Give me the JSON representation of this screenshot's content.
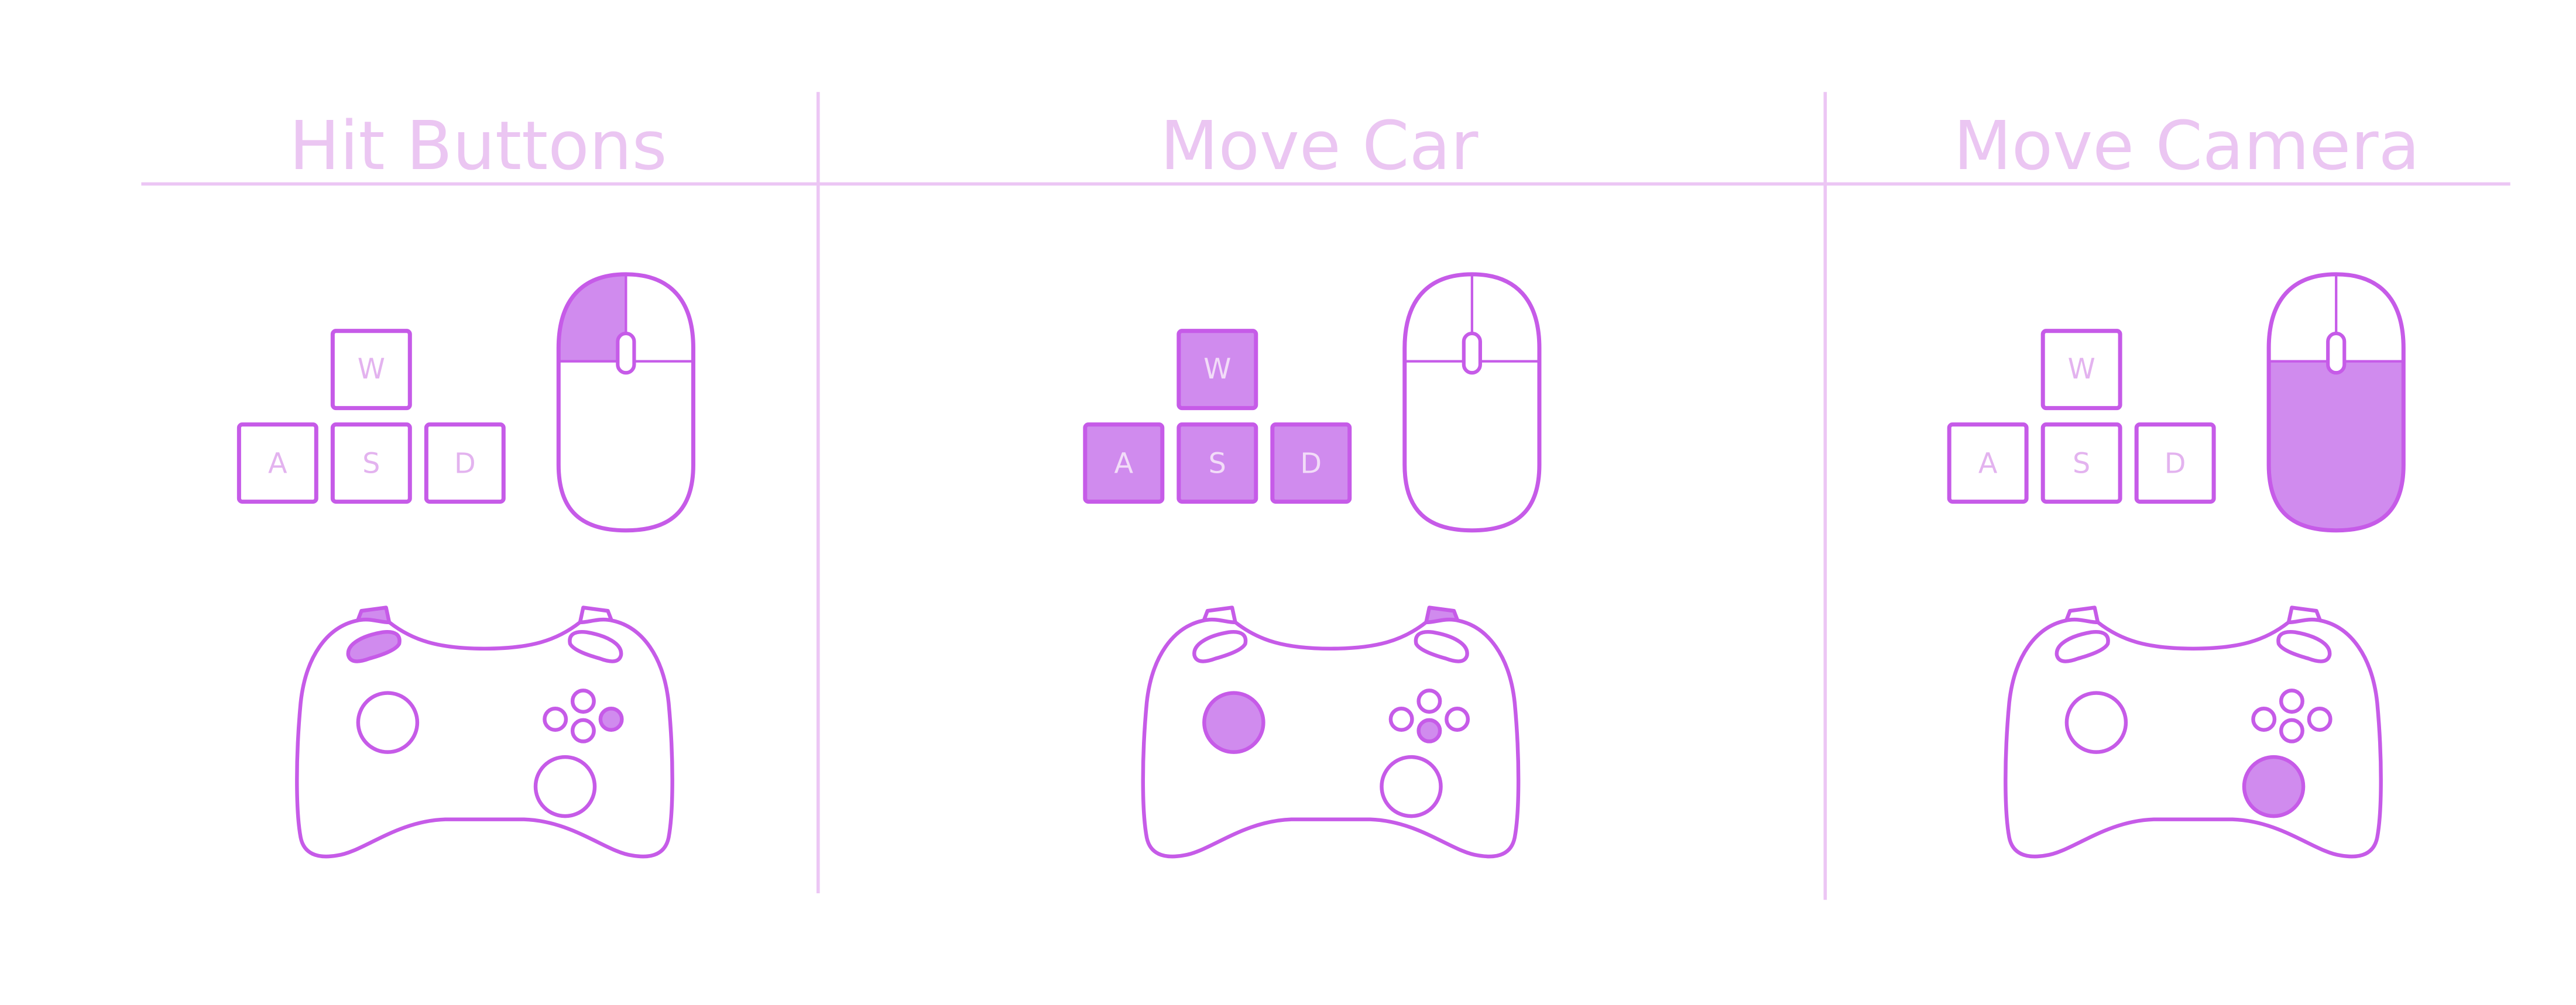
{
  "colors": {
    "outline": "#c65be8",
    "fill": "#d08bee",
    "title": "#ebc6f2",
    "divider": "#ecc6f4",
    "key_label_inactive": "#e3b3ef",
    "key_label_active": "#f2dcf8"
  },
  "icons": [
    "keyboard-wasd-icon",
    "mouse-icon",
    "gamepad-icon"
  ],
  "panels": [
    {
      "title": "Hit Buttons",
      "keys": {
        "w": {
          "label": "W",
          "active": false
        },
        "a": {
          "label": "A",
          "active": false
        },
        "s": {
          "label": "S",
          "active": false
        },
        "d": {
          "label": "D",
          "active": false
        }
      },
      "mouse": {
        "left_button": true,
        "right_button": false,
        "body": false
      },
      "gamepad": {
        "left_bumper": true,
        "left_trigger": true,
        "right_bumper": false,
        "right_trigger": false,
        "left_stick": false,
        "right_stick": false,
        "btn_top": false,
        "btn_left": false,
        "btn_right": true,
        "btn_bottom": false
      }
    },
    {
      "title": "Move Car",
      "keys": {
        "w": {
          "label": "W",
          "active": true
        },
        "a": {
          "label": "A",
          "active": true
        },
        "s": {
          "label": "S",
          "active": true
        },
        "d": {
          "label": "D",
          "active": true
        }
      },
      "mouse": {
        "left_button": false,
        "right_button": false,
        "body": false
      },
      "gamepad": {
        "left_bumper": false,
        "left_trigger": false,
        "right_bumper": false,
        "right_trigger": true,
        "left_stick": true,
        "right_stick": false,
        "btn_top": false,
        "btn_left": false,
        "btn_right": false,
        "btn_bottom": true
      }
    },
    {
      "title": "Move Camera",
      "keys": {
        "w": {
          "label": "W",
          "active": false
        },
        "a": {
          "label": "A",
          "active": false
        },
        "s": {
          "label": "S",
          "active": false
        },
        "d": {
          "label": "D",
          "active": false
        }
      },
      "mouse": {
        "left_button": false,
        "right_button": false,
        "body": true
      },
      "gamepad": {
        "left_bumper": false,
        "left_trigger": false,
        "right_bumper": false,
        "right_trigger": false,
        "left_stick": false,
        "right_stick": true,
        "btn_top": false,
        "btn_left": false,
        "btn_right": false,
        "btn_bottom": false
      }
    }
  ]
}
